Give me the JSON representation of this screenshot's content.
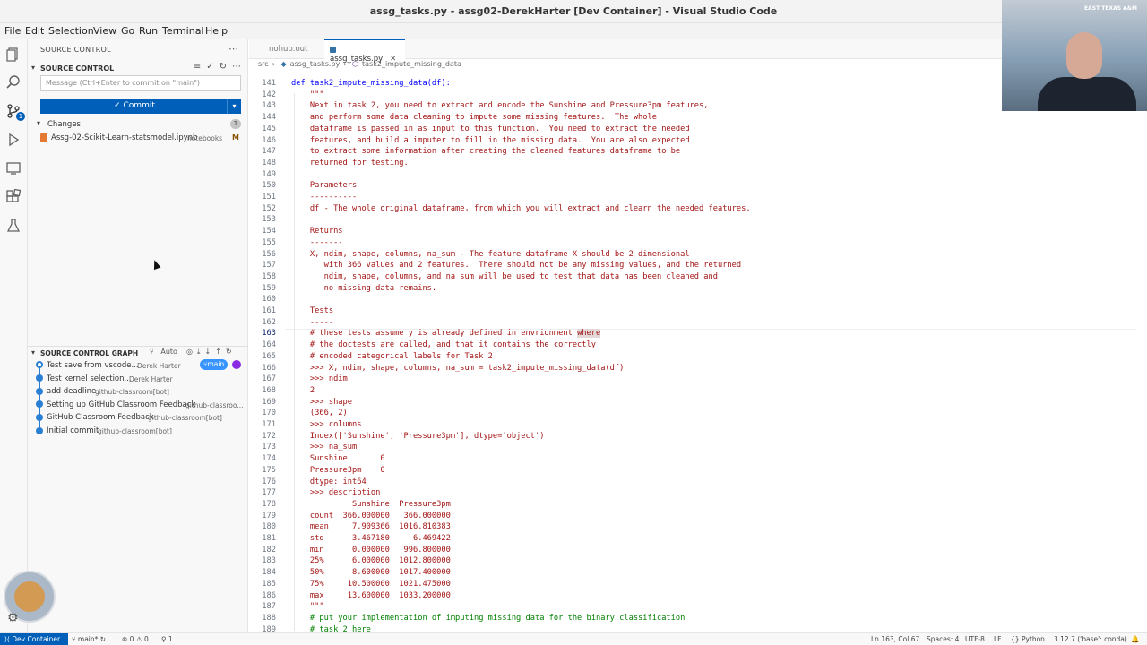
{
  "window": {
    "title": "assg_tasks.py - assg02-DerekHarter [Dev Container] - Visual Studio Code"
  },
  "menu": [
    "File",
    "Edit",
    "Selection",
    "View",
    "Go",
    "Run",
    "Terminal",
    "Help"
  ],
  "activity": {
    "scm_badge": "1"
  },
  "sidebar": {
    "header": "SOURCE CONTROL",
    "section": "SOURCE CONTROL",
    "message_placeholder": "Message (Ctrl+Enter to commit on \"main\")",
    "commit_label": "Commit",
    "changes_label": "Changes",
    "changes_count": "1",
    "file": {
      "name": "Assg-02-Scikit-Learn-statsmodel.ipynb",
      "dir": "notebooks",
      "status": "M"
    },
    "graph": {
      "header": "SOURCE CONTROL GRAPH",
      "auto_label": "Auto",
      "branch_pill": "main",
      "commits": [
        {
          "message": "Test save from vscode...",
          "author": "Derek Harter"
        },
        {
          "message": "Test kernel selection...",
          "author": "Derek Harter"
        },
        {
          "message": "add deadline",
          "author": "github-classroom[bot]"
        },
        {
          "message": "Setting up GitHub Classroom Feedback",
          "author": "github-classroo..."
        },
        {
          "message": "GitHub Classroom Feedback",
          "author": "github-classroom[bot]"
        },
        {
          "message": "Initial commit",
          "author": "github-classroom[bot]"
        }
      ]
    }
  },
  "tabs": [
    {
      "label": "nohup.out",
      "active": false
    },
    {
      "label": "assg_tasks.py",
      "active": true
    }
  ],
  "breadcrumbs": [
    "src",
    "assg_tasks.py",
    "task2_impute_missing_data"
  ],
  "code": [
    {
      "n": "141",
      "t": "def task2_impute_missing_data(df):",
      "k": "kw"
    },
    {
      "n": "142",
      "t": "    \"\"\"",
      "k": ""
    },
    {
      "n": "143",
      "t": "    Next in task 2, you need to extract and encode the Sunshine and Pressure3pm features,",
      "k": ""
    },
    {
      "n": "144",
      "t": "    and perform some data cleaning to impute some missing features.  The whole",
      "k": ""
    },
    {
      "n": "145",
      "t": "    dataframe is passed in as input to this function.  You need to extract the needed",
      "k": ""
    },
    {
      "n": "146",
      "t": "    features, and build a imputer to fill in the missing data.  You are also expected",
      "k": ""
    },
    {
      "n": "147",
      "t": "    to extract some information after creating the cleaned features dataframe to be",
      "k": ""
    },
    {
      "n": "148",
      "t": "    returned for testing.",
      "k": ""
    },
    {
      "n": "149",
      "t": "",
      "k": ""
    },
    {
      "n": "150",
      "t": "    Parameters",
      "k": ""
    },
    {
      "n": "151",
      "t": "    ----------",
      "k": ""
    },
    {
      "n": "152",
      "t": "    df - The whole original dataframe, from which you will extract and clearn the needed features.",
      "k": ""
    },
    {
      "n": "153",
      "t": "",
      "k": ""
    },
    {
      "n": "154",
      "t": "    Returns",
      "k": ""
    },
    {
      "n": "155",
      "t": "    -------",
      "k": ""
    },
    {
      "n": "156",
      "t": "    X, ndim, shape, columns, na_sum - The feature dataframe X should be 2 dimensional",
      "k": ""
    },
    {
      "n": "157",
      "t": "       with 366 values and 2 features.  There should not be any missing values, and the returned",
      "k": ""
    },
    {
      "n": "158",
      "t": "       ndim, shape, columns, and na_sum will be used to test that data has been cleaned and",
      "k": ""
    },
    {
      "n": "159",
      "t": "       no missing data remains.",
      "k": ""
    },
    {
      "n": "160",
      "t": "",
      "k": ""
    },
    {
      "n": "161",
      "t": "    Tests",
      "k": ""
    },
    {
      "n": "162",
      "t": "    -----",
      "k": ""
    },
    {
      "n": "163",
      "t": "    # these tests assume y is already defined in envrionment where",
      "k": ""
    },
    {
      "n": "164",
      "t": "    # the doctests are called, and that it contains the correctly",
      "k": ""
    },
    {
      "n": "165",
      "t": "    # encoded categorical labels for Task 2",
      "k": ""
    },
    {
      "n": "166",
      "t": "    >>> X, ndim, shape, columns, na_sum = task2_impute_missing_data(df)",
      "k": ""
    },
    {
      "n": "167",
      "t": "    >>> ndim",
      "k": ""
    },
    {
      "n": "168",
      "t": "    2",
      "k": ""
    },
    {
      "n": "169",
      "t": "    >>> shape",
      "k": ""
    },
    {
      "n": "170",
      "t": "    (366, 2)",
      "k": ""
    },
    {
      "n": "171",
      "t": "    >>> columns",
      "k": ""
    },
    {
      "n": "172",
      "t": "    Index(['Sunshine', 'Pressure3pm'], dtype='object')",
      "k": ""
    },
    {
      "n": "173",
      "t": "    >>> na_sum",
      "k": ""
    },
    {
      "n": "174",
      "t": "    Sunshine       0",
      "k": ""
    },
    {
      "n": "175",
      "t": "    Pressure3pm    0",
      "k": ""
    },
    {
      "n": "176",
      "t": "    dtype: int64",
      "k": ""
    },
    {
      "n": "177",
      "t": "    >>> description",
      "k": ""
    },
    {
      "n": "178",
      "t": "             Sunshine  Pressure3pm",
      "k": ""
    },
    {
      "n": "179",
      "t": "    count  366.000000   366.000000",
      "k": ""
    },
    {
      "n": "180",
      "t": "    mean     7.909366  1016.810383",
      "k": ""
    },
    {
      "n": "181",
      "t": "    std      3.467180     6.469422",
      "k": ""
    },
    {
      "n": "182",
      "t": "    min      0.000000   996.800000",
      "k": ""
    },
    {
      "n": "183",
      "t": "    25%      6.000000  1012.800000",
      "k": ""
    },
    {
      "n": "184",
      "t": "    50%      8.600000  1017.400000",
      "k": ""
    },
    {
      "n": "185",
      "t": "    75%     10.500000  1021.475000",
      "k": ""
    },
    {
      "n": "186",
      "t": "    max     13.600000  1033.200000",
      "k": ""
    },
    {
      "n": "187",
      "t": "    \"\"\"",
      "k": ""
    },
    {
      "n": "188",
      "t": "    # put your implementation of imputing missing data for the binary classification",
      "k": "cm"
    },
    {
      "n": "189",
      "t": "    # task 2 here",
      "k": "cm"
    }
  ],
  "status": {
    "remote": "Dev Container",
    "branch": "main*",
    "errors": "0",
    "warnings": "0",
    "ports": "1",
    "position": "Ln 163, Col 67",
    "spaces": "Spaces: 4",
    "encoding": "UTF-8",
    "eol": "LF",
    "language": "Python",
    "interpreter": "3.12.7 ('base': conda)"
  },
  "colors": {
    "accent": "#005fb8",
    "string": "#a31515",
    "keyword": "#0000ff",
    "comment": "#008000"
  }
}
